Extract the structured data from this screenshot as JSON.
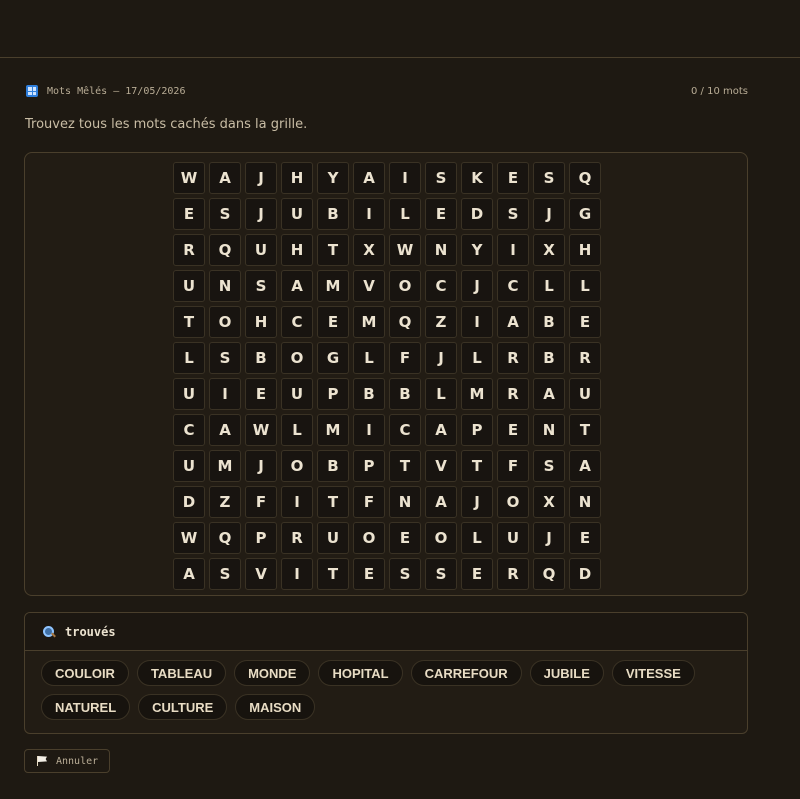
{
  "header": {
    "title": "Mots Mêlés — 17/05/2026",
    "count": "0 / 10 mots"
  },
  "instructions": "Trouvez tous les mots cachés dans la grille.",
  "grid": [
    [
      "W",
      "A",
      "J",
      "H",
      "Y",
      "A",
      "I",
      "S",
      "K",
      "E",
      "S",
      "Q"
    ],
    [
      "E",
      "S",
      "J",
      "U",
      "B",
      "I",
      "L",
      "E",
      "D",
      "S",
      "J",
      "G"
    ],
    [
      "R",
      "Q",
      "U",
      "H",
      "T",
      "X",
      "W",
      "N",
      "Y",
      "I",
      "X",
      "H"
    ],
    [
      "U",
      "N",
      "S",
      "A",
      "M",
      "V",
      "O",
      "C",
      "J",
      "C",
      "L",
      "L"
    ],
    [
      "T",
      "O",
      "H",
      "C",
      "E",
      "M",
      "Q",
      "Z",
      "I",
      "A",
      "B",
      "E"
    ],
    [
      "L",
      "S",
      "B",
      "O",
      "G",
      "L",
      "F",
      "J",
      "L",
      "R",
      "B",
      "R"
    ],
    [
      "U",
      "I",
      "E",
      "U",
      "P",
      "B",
      "B",
      "L",
      "M",
      "R",
      "A",
      "U"
    ],
    [
      "C",
      "A",
      "W",
      "L",
      "M",
      "I",
      "C",
      "A",
      "P",
      "E",
      "N",
      "T"
    ],
    [
      "U",
      "M",
      "J",
      "O",
      "B",
      "P",
      "T",
      "V",
      "T",
      "F",
      "S",
      "A"
    ],
    [
      "D",
      "Z",
      "F",
      "I",
      "T",
      "F",
      "N",
      "A",
      "J",
      "O",
      "X",
      "N"
    ],
    [
      "W",
      "Q",
      "P",
      "R",
      "U",
      "O",
      "E",
      "O",
      "L",
      "U",
      "J",
      "E"
    ],
    [
      "A",
      "S",
      "V",
      "I",
      "T",
      "E",
      "S",
      "S",
      "E",
      "R",
      "Q",
      "D"
    ]
  ],
  "found_panel": {
    "title": "trouvés",
    "icon": "search-icon",
    "words": [
      "COULOIR",
      "TABLEAU",
      "MONDE",
      "HOPITAL",
      "CARREFOUR",
      "JUBILE",
      "VITESSE",
      "NATUREL",
      "CULTURE",
      "MAISON"
    ]
  },
  "undo": {
    "label": "Annuler",
    "icon": "flag-icon"
  },
  "colors": {
    "background": "#1e1912",
    "panel": "#221c14",
    "cell": "#181410",
    "border": "#4a3f2c",
    "text": "#e8dcc4"
  }
}
